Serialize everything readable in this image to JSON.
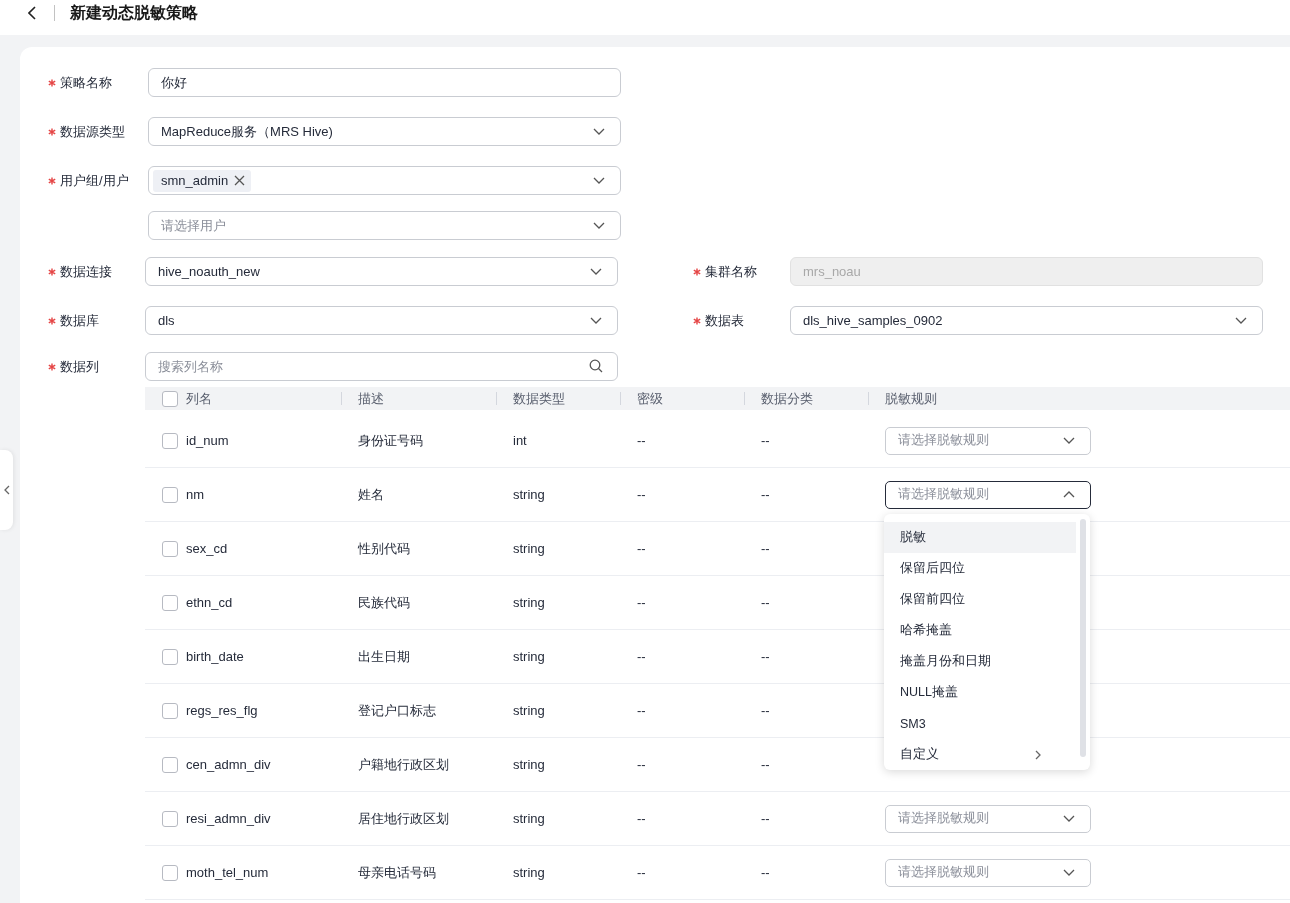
{
  "header": {
    "title": "新建动态脱敏策略"
  },
  "form": {
    "rows": [
      {
        "kind": "input",
        "label": "策略名称",
        "required": true,
        "value": "你好"
      },
      {
        "kind": "select",
        "label": "数据源类型",
        "required": true,
        "value": "MapReduce服务（MRS Hive)"
      },
      {
        "kind": "tags",
        "label": "用户组/用户",
        "required": true,
        "tags": [
          "smn_admin"
        ]
      },
      {
        "kind": "select",
        "placeholder": "请选择用户"
      }
    ],
    "pairs": [
      [
        {
          "kind": "select",
          "label": "数据连接",
          "required": true,
          "value": "hive_noauth_new"
        },
        {
          "kind": "disabled",
          "label": "集群名称",
          "required": true,
          "value": "mrs_noau"
        }
      ],
      [
        {
          "kind": "select",
          "label": "数据库",
          "required": true,
          "value": "dls"
        },
        {
          "kind": "select",
          "label": "数据表",
          "required": true,
          "value": "dls_hive_samples_0902"
        }
      ]
    ],
    "columns_field": {
      "label": "数据列",
      "required": true,
      "placeholder": "搜索列名称"
    }
  },
  "table": {
    "header_checked": false,
    "columns": [
      "列名",
      "描述",
      "数据类型",
      "密级",
      "数据分类",
      "脱敏规则"
    ],
    "rows": [
      {
        "checked": false,
        "name": "id_num",
        "desc": "身份证号码",
        "type": "int",
        "secrecy": "--",
        "category": "--",
        "rule": {
          "placeholder": "请选择脱敏规则",
          "open": false
        }
      },
      {
        "checked": false,
        "name": "nm",
        "desc": "姓名",
        "type": "string",
        "secrecy": "--",
        "category": "--",
        "rule": {
          "placeholder": "请选择脱敏规则",
          "open": true
        }
      },
      {
        "checked": false,
        "name": "sex_cd",
        "desc": "性别代码",
        "type": "string",
        "secrecy": "--",
        "category": "--"
      },
      {
        "checked": false,
        "name": "ethn_cd",
        "desc": "民族代码",
        "type": "string",
        "secrecy": "--",
        "category": "--"
      },
      {
        "checked": false,
        "name": "birth_date",
        "desc": "出生日期",
        "type": "string",
        "secrecy": "--",
        "category": "--"
      },
      {
        "checked": false,
        "name": "regs_res_flg",
        "desc": "登记户口标志",
        "type": "string",
        "secrecy": "--",
        "category": "--"
      },
      {
        "checked": false,
        "name": "cen_admn_div",
        "desc": "户籍地行政区划",
        "type": "string",
        "secrecy": "--",
        "category": "--"
      },
      {
        "checked": false,
        "name": "resi_admn_div",
        "desc": "居住地行政区划",
        "type": "string",
        "secrecy": "--",
        "category": "--",
        "rule": {
          "placeholder": "请选择脱敏规则",
          "open": false
        }
      },
      {
        "checked": false,
        "name": "moth_tel_num",
        "desc": "母亲电话号码",
        "type": "string",
        "secrecy": "--",
        "category": "--",
        "rule": {
          "placeholder": "请选择脱敏规则",
          "open": false
        }
      }
    ]
  },
  "rule_menu": {
    "items": [
      {
        "label": "脱敏",
        "highlighted": true,
        "submenu": false
      },
      {
        "label": "保留后四位",
        "highlighted": false,
        "submenu": false
      },
      {
        "label": "保留前四位",
        "highlighted": false,
        "submenu": false
      },
      {
        "label": "哈希掩盖",
        "highlighted": false,
        "submenu": false
      },
      {
        "label": "掩盖月份和日期",
        "highlighted": false,
        "submenu": false
      },
      {
        "label": "NULL掩盖",
        "highlighted": false,
        "submenu": false
      },
      {
        "label": "SM3",
        "highlighted": false,
        "submenu": false
      },
      {
        "label": "自定义",
        "highlighted": false,
        "submenu": true
      }
    ]
  }
}
